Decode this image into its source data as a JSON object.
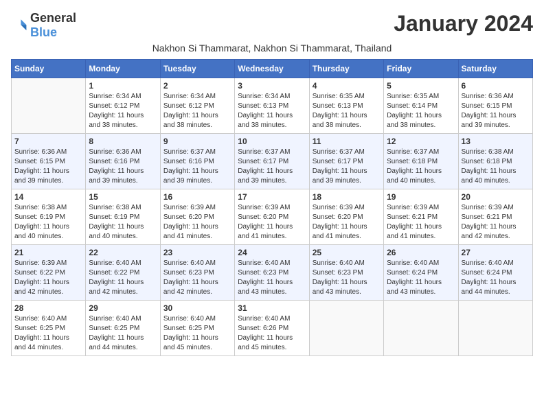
{
  "logo": {
    "general": "General",
    "blue": "Blue"
  },
  "title": "January 2024",
  "location": "Nakhon Si Thammarat, Nakhon Si Thammarat, Thailand",
  "days_of_week": [
    "Sunday",
    "Monday",
    "Tuesday",
    "Wednesday",
    "Thursday",
    "Friday",
    "Saturday"
  ],
  "weeks": [
    [
      {
        "day": "",
        "info": ""
      },
      {
        "day": "1",
        "info": "Sunrise: 6:34 AM\nSunset: 6:12 PM\nDaylight: 11 hours\nand 38 minutes."
      },
      {
        "day": "2",
        "info": "Sunrise: 6:34 AM\nSunset: 6:12 PM\nDaylight: 11 hours\nand 38 minutes."
      },
      {
        "day": "3",
        "info": "Sunrise: 6:34 AM\nSunset: 6:13 PM\nDaylight: 11 hours\nand 38 minutes."
      },
      {
        "day": "4",
        "info": "Sunrise: 6:35 AM\nSunset: 6:13 PM\nDaylight: 11 hours\nand 38 minutes."
      },
      {
        "day": "5",
        "info": "Sunrise: 6:35 AM\nSunset: 6:14 PM\nDaylight: 11 hours\nand 38 minutes."
      },
      {
        "day": "6",
        "info": "Sunrise: 6:36 AM\nSunset: 6:15 PM\nDaylight: 11 hours\nand 39 minutes."
      }
    ],
    [
      {
        "day": "7",
        "info": "Sunrise: 6:36 AM\nSunset: 6:15 PM\nDaylight: 11 hours\nand 39 minutes."
      },
      {
        "day": "8",
        "info": "Sunrise: 6:36 AM\nSunset: 6:16 PM\nDaylight: 11 hours\nand 39 minutes."
      },
      {
        "day": "9",
        "info": "Sunrise: 6:37 AM\nSunset: 6:16 PM\nDaylight: 11 hours\nand 39 minutes."
      },
      {
        "day": "10",
        "info": "Sunrise: 6:37 AM\nSunset: 6:17 PM\nDaylight: 11 hours\nand 39 minutes."
      },
      {
        "day": "11",
        "info": "Sunrise: 6:37 AM\nSunset: 6:17 PM\nDaylight: 11 hours\nand 39 minutes."
      },
      {
        "day": "12",
        "info": "Sunrise: 6:37 AM\nSunset: 6:18 PM\nDaylight: 11 hours\nand 40 minutes."
      },
      {
        "day": "13",
        "info": "Sunrise: 6:38 AM\nSunset: 6:18 PM\nDaylight: 11 hours\nand 40 minutes."
      }
    ],
    [
      {
        "day": "14",
        "info": "Sunrise: 6:38 AM\nSunset: 6:19 PM\nDaylight: 11 hours\nand 40 minutes."
      },
      {
        "day": "15",
        "info": "Sunrise: 6:38 AM\nSunset: 6:19 PM\nDaylight: 11 hours\nand 40 minutes."
      },
      {
        "day": "16",
        "info": "Sunrise: 6:39 AM\nSunset: 6:20 PM\nDaylight: 11 hours\nand 41 minutes."
      },
      {
        "day": "17",
        "info": "Sunrise: 6:39 AM\nSunset: 6:20 PM\nDaylight: 11 hours\nand 41 minutes."
      },
      {
        "day": "18",
        "info": "Sunrise: 6:39 AM\nSunset: 6:20 PM\nDaylight: 11 hours\nand 41 minutes."
      },
      {
        "day": "19",
        "info": "Sunrise: 6:39 AM\nSunset: 6:21 PM\nDaylight: 11 hours\nand 41 minutes."
      },
      {
        "day": "20",
        "info": "Sunrise: 6:39 AM\nSunset: 6:21 PM\nDaylight: 11 hours\nand 42 minutes."
      }
    ],
    [
      {
        "day": "21",
        "info": "Sunrise: 6:39 AM\nSunset: 6:22 PM\nDaylight: 11 hours\nand 42 minutes."
      },
      {
        "day": "22",
        "info": "Sunrise: 6:40 AM\nSunset: 6:22 PM\nDaylight: 11 hours\nand 42 minutes."
      },
      {
        "day": "23",
        "info": "Sunrise: 6:40 AM\nSunset: 6:23 PM\nDaylight: 11 hours\nand 42 minutes."
      },
      {
        "day": "24",
        "info": "Sunrise: 6:40 AM\nSunset: 6:23 PM\nDaylight: 11 hours\nand 43 minutes."
      },
      {
        "day": "25",
        "info": "Sunrise: 6:40 AM\nSunset: 6:23 PM\nDaylight: 11 hours\nand 43 minutes."
      },
      {
        "day": "26",
        "info": "Sunrise: 6:40 AM\nSunset: 6:24 PM\nDaylight: 11 hours\nand 43 minutes."
      },
      {
        "day": "27",
        "info": "Sunrise: 6:40 AM\nSunset: 6:24 PM\nDaylight: 11 hours\nand 44 minutes."
      }
    ],
    [
      {
        "day": "28",
        "info": "Sunrise: 6:40 AM\nSunset: 6:25 PM\nDaylight: 11 hours\nand 44 minutes."
      },
      {
        "day": "29",
        "info": "Sunrise: 6:40 AM\nSunset: 6:25 PM\nDaylight: 11 hours\nand 44 minutes."
      },
      {
        "day": "30",
        "info": "Sunrise: 6:40 AM\nSunset: 6:25 PM\nDaylight: 11 hours\nand 45 minutes."
      },
      {
        "day": "31",
        "info": "Sunrise: 6:40 AM\nSunset: 6:26 PM\nDaylight: 11 hours\nand 45 minutes."
      },
      {
        "day": "",
        "info": ""
      },
      {
        "day": "",
        "info": ""
      },
      {
        "day": "",
        "info": ""
      }
    ]
  ]
}
